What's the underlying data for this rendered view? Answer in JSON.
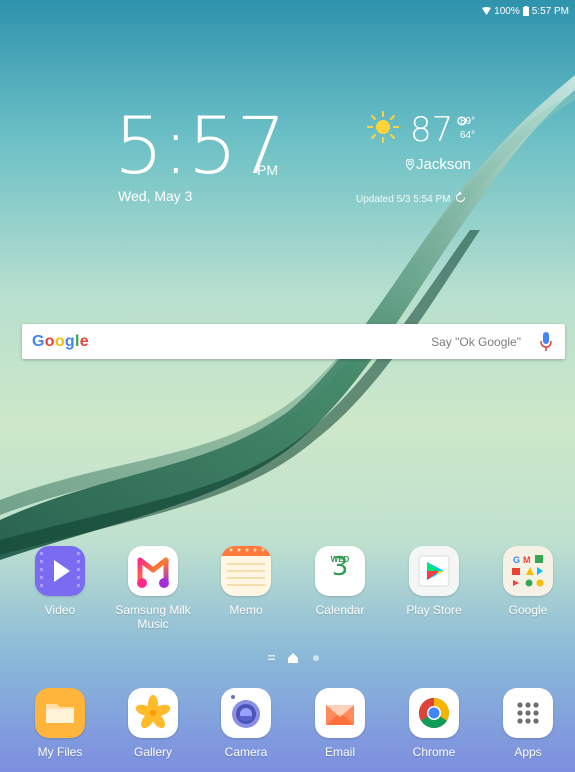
{
  "status_bar": {
    "battery": "100%",
    "time": "5:57 PM"
  },
  "clock": {
    "time": "5:57",
    "ampm": "PM",
    "date": "Wed, May 3"
  },
  "weather": {
    "temp": "87°",
    "high": "89°",
    "low": "64°",
    "location": "Jackson",
    "updated": "Updated 5/3  5:54 PM",
    "icon": "sunny-icon"
  },
  "search": {
    "logo": "Google",
    "hint": "Say \"Ok Google\""
  },
  "apps": [
    {
      "label": "Video",
      "icon": "video-icon"
    },
    {
      "label": "Samsung Milk Music",
      "icon": "samsung-milk-music-icon"
    },
    {
      "label": "Memo",
      "icon": "memo-icon"
    },
    {
      "label": "Calendar",
      "icon": "calendar-icon",
      "day": "WED",
      "date": "3"
    },
    {
      "label": "Play Store",
      "icon": "play-store-icon"
    },
    {
      "label": "Google",
      "icon": "google-folder-icon"
    }
  ],
  "dock": [
    {
      "label": "My Files",
      "icon": "my-files-icon"
    },
    {
      "label": "Gallery",
      "icon": "gallery-icon"
    },
    {
      "label": "Camera",
      "icon": "camera-icon"
    },
    {
      "label": "Email",
      "icon": "email-icon"
    },
    {
      "label": "Chrome",
      "icon": "chrome-icon"
    },
    {
      "label": "Apps",
      "icon": "apps-grid-icon"
    }
  ],
  "colors": {
    "google_blue": "#4285F4",
    "google_red": "#EA4335",
    "google_yellow": "#FBBC05",
    "google_green": "#34A853"
  }
}
